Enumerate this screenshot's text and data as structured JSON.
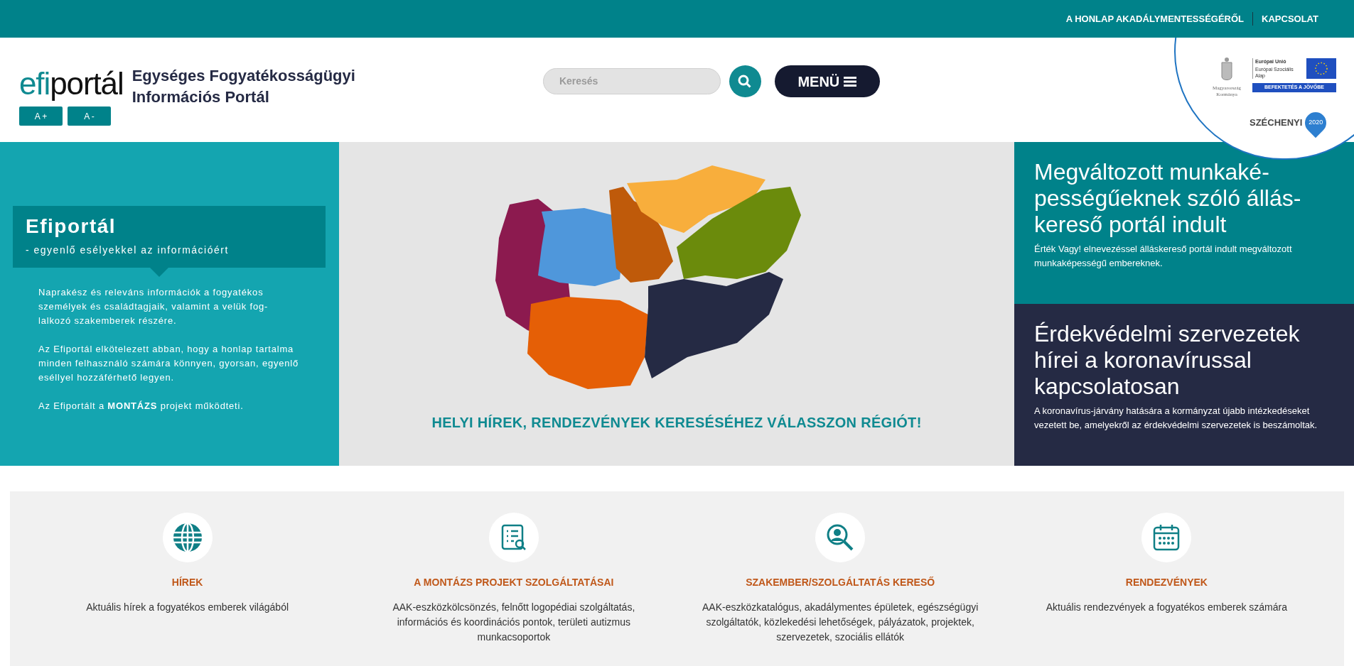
{
  "top_nav": {
    "links": [
      "A HONLAP AKADÁLYMENTESSÉGÉRŐL",
      "KAPCSOLAT"
    ]
  },
  "header": {
    "logo": {
      "part_1": "efi",
      "part_2": "portál"
    },
    "site_title": "Egységes Fogyatékosságügyi\nInformációs Portál",
    "font_buttons": [
      "A +",
      "A -"
    ],
    "search": {
      "placeholder": "Keresés"
    },
    "menu_button": "MENÜ",
    "sponsor_badge": {
      "government": "Magyarország\nKormánya",
      "eu_title": "Európai Unió",
      "eu_fund": "Európai Szociális\nAlap",
      "eu_slogan": "BEFEKTETÉS A JÖVŐBE",
      "programme": "SZÉCHENYI",
      "programme_year": "2020"
    }
  },
  "intro": {
    "title": "Efiportál",
    "subtitle": "- egyenlő esélyekkel az információért",
    "paragraphs": [
      "Naprakész és releváns információk a fogyatékos személyek és családtagjaik, valamint a velük fog-\nlalkozó szakemberek részére.",
      "Az Efiportál elkötelezett abban, hogy a honlap tartalma minden felhasználó számára könnyen, gyorsan, egyenlő eséllyel hozzáférhető legyen.",
      "Az Efiportált a **MONTÁZS** projekt működteti."
    ]
  },
  "region_map": {
    "caption": "HELYI HÍREK, RENDEZVÉNYEK KERESÉSÉHEZ VÁLASSZON RÉGIÓT!"
  },
  "news": [
    {
      "title": "Megváltozott munkaké-\npességűeknek szóló állás-\nkereső portál indult",
      "summary": "Érték Vagy! elnevezéssel álláskereső portál indult megváltozott munkaképességű embereknek.",
      "color": "#00828a"
    },
    {
      "title": "Érdekvédelmi szervezetek hírei a koronavírussal kapcsolatosan",
      "summary": "A koronavírus-járvány hatására a kormányzat újabb intézkedéseket vezetett be, amelyekről az érdekvédelmi szervezetek is beszámoltak.",
      "color": "#252a44"
    }
  ],
  "services": [
    {
      "kind": "globe",
      "title": "HÍREK",
      "text": "Aktuális hírek a fogyatékos emberek világából"
    },
    {
      "kind": "list",
      "title": "A MONTÁZS PROJEKT SZOLGÁLTATÁSAI",
      "text": "AAK-eszközkölcsönzés, felnőtt logopédiai szolgáltatás, információs és koordinációs pontok, területi autizmus munkacsoportok"
    },
    {
      "kind": "person",
      "title": "SZAKEMBER/SZOLGÁLTATÁS KERESŐ",
      "text": "AAK-eszközkatalógus, akadálymentes épületek, egészségügyi szolgáltatók, közlekedési lehetőségek, pályázatok, projektek, szervezetek, szociális ellátók"
    },
    {
      "kind": "calendar",
      "title": "RENDEZVÉNYEK",
      "text": "Aktuális rendezvények a fogyatékos emberek számára"
    }
  ]
}
